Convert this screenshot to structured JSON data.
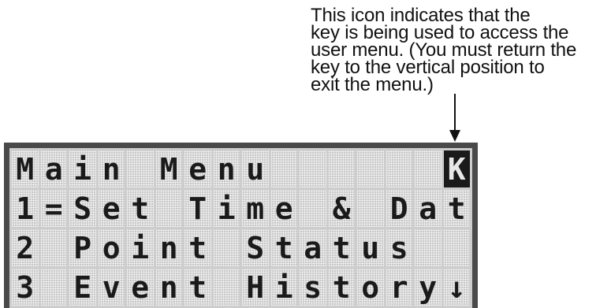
{
  "callout": {
    "lines": [
      "This icon indicates that the",
      "key is being used to access the",
      "user menu. (You must return the",
      "key to the vertical position to",
      "exit the menu.)"
    ]
  },
  "lcd": {
    "rows": [
      {
        "text": "Main Menu",
        "right": "K"
      },
      {
        "text": "1=Set Time & Date",
        "right": ""
      },
      {
        "text": "2 Point Status",
        "right": ""
      },
      {
        "text": "3 Event History",
        "right": "↓"
      }
    ]
  }
}
